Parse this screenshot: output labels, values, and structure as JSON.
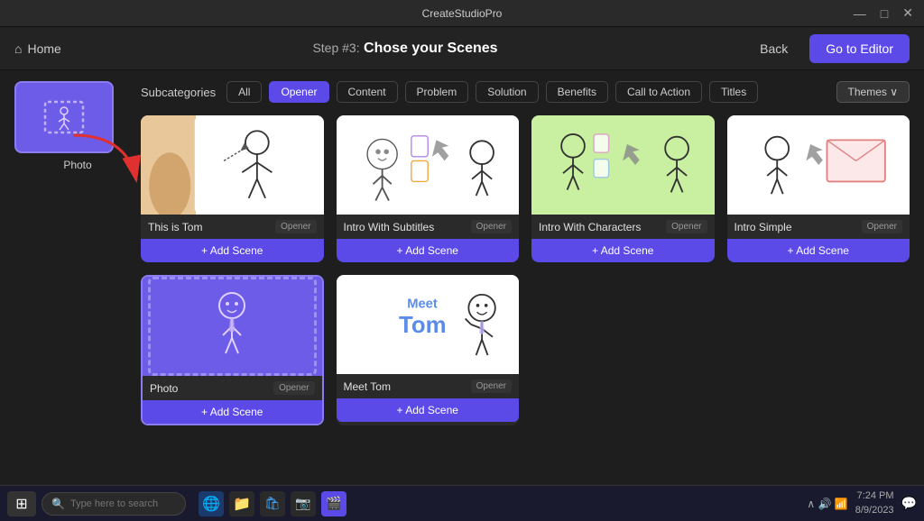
{
  "titlebar": {
    "title": "CreateStudioPro",
    "minimize": "—",
    "maximize": "□",
    "close": "✕"
  },
  "topnav": {
    "home_icon": "⌂",
    "home_label": "Home",
    "step_label": "Step #3:",
    "page_title": "Chose your Scenes",
    "back_label": "Back",
    "editor_label": "Go to Editor"
  },
  "subcategories": {
    "label": "Subcategories",
    "buttons": [
      "All",
      "Opener",
      "Content",
      "Problem",
      "Solution",
      "Benefits",
      "Call to Action",
      "Titles"
    ],
    "active": "Opener",
    "themes_label": "Themes ∨"
  },
  "selected_scene": {
    "label": "Photo"
  },
  "scenes": [
    {
      "name": "This is Tom",
      "badge": "Opener",
      "add_label": "+ Add Scene",
      "type": "this-is-tom"
    },
    {
      "name": "Intro With Subtitles",
      "badge": "Opener",
      "add_label": "+ Add Scene",
      "type": "intro-subtitles"
    },
    {
      "name": "Intro With Characters",
      "badge": "Opener",
      "add_label": "+ Add Scene",
      "type": "intro-characters"
    },
    {
      "name": "Intro Simple",
      "badge": "Opener",
      "add_label": "+ Add Scene",
      "type": "intro-simple"
    },
    {
      "name": "Photo",
      "badge": "Opener",
      "add_label": "+ Add Scene",
      "type": "photo"
    },
    {
      "name": "Meet Tom",
      "badge": "Opener",
      "add_label": "+ Add Scene",
      "type": "meet-tom"
    }
  ],
  "taskbar": {
    "search_placeholder": "Type here to search",
    "time": "7:24 PM",
    "date": "8/9/2023"
  }
}
